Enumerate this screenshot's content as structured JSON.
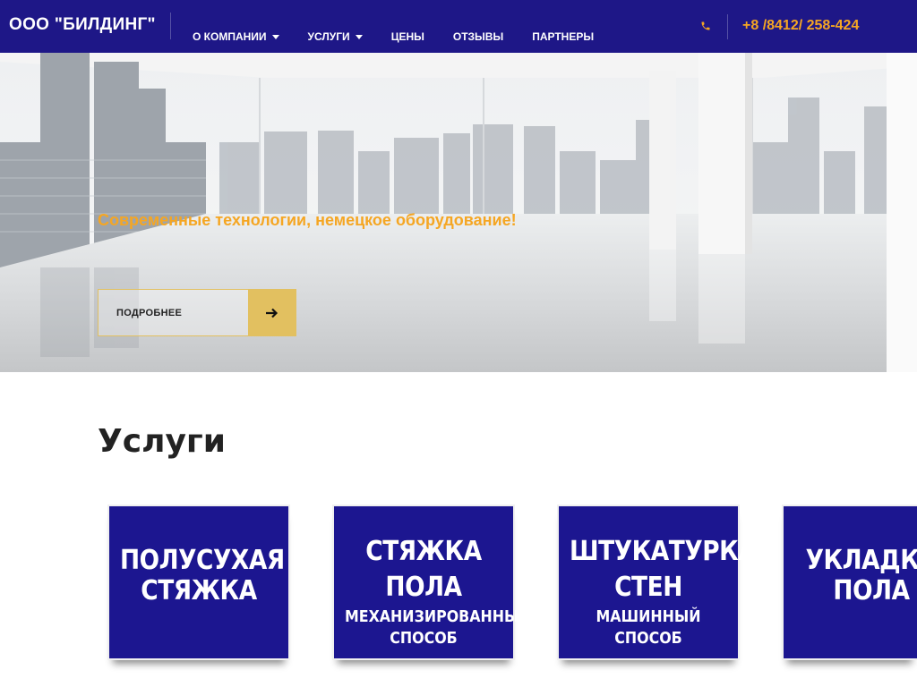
{
  "header": {
    "logo": "ООО \"БИЛДИНГ\"",
    "nav": [
      {
        "label": "О КОМПАНИИ",
        "has_dropdown": true
      },
      {
        "label": "УСЛУГИ",
        "has_dropdown": true
      },
      {
        "label": "ЦЕНЫ",
        "has_dropdown": false
      },
      {
        "label": "ОТЗЫВЫ",
        "has_dropdown": false
      },
      {
        "label": "ПАРТНЕРЫ",
        "has_dropdown": false
      }
    ],
    "phone_icon": "phone-icon",
    "phone": "+8 /8412/ 258-424"
  },
  "hero": {
    "tagline": "Современные технологии, немецкое оборудование!",
    "button_label": "ПОДРОБНЕЕ",
    "button_icon": "arrow-right-icon"
  },
  "services": {
    "title": "Услуги",
    "cards": [
      {
        "line1": "ПОЛУСУХАЯ",
        "line2": "СТЯЖКА",
        "sub1": "",
        "sub2": ""
      },
      {
        "line1": "СТЯЖКА",
        "line2": "ПОЛА",
        "sub1": "МЕХАНИЗИРОВАННЫЙ",
        "sub2": "СПОСОБ"
      },
      {
        "line1": "ШТУКАТУРКА",
        "line2": "СТЕН",
        "sub1": "МАШИННЫЙ",
        "sub2": "СПОСОБ"
      },
      {
        "line1": "УКЛАДКА",
        "line2": "ПОЛА",
        "sub1": "",
        "sub2": ""
      }
    ]
  },
  "colors": {
    "header_bg": "#1e1787",
    "accent_orange": "#f5a623",
    "button_gold": "#e2c060",
    "card_bg": "#1c1690"
  }
}
